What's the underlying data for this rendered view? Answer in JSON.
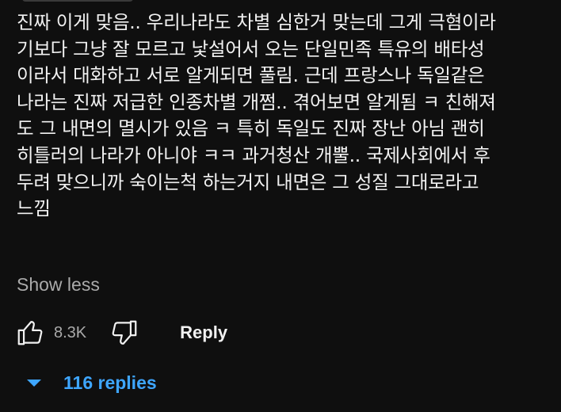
{
  "comment": {
    "lines": [
      "진짜 이게 맞음.. 우리나라도 차별 심한거 맞는데 그게 극혐이라",
      "기보다 그냥 잘 모르고 낯설어서 오는 단일민족 특유의 배타성",
      "이라서 대화하고 서로 알게되면 풀림. 근데 프랑스나 독일같은",
      "나라는 진짜 저급한 인종차별 개쩜.. 겪어보면 알게됨 ㅋ 친해져",
      "도 그 내면의 멸시가 있음 ㅋ 특히 독일도 진짜 장난 아님 괜히",
      "히틀러의 나라가 아니야 ㅋㅋ 과거청산 개뿔.. 국제사회에서 후",
      "두려 맞으니까 숙이는척 하는거지 내면은 그 성질 그대로라고",
      "느낌"
    ],
    "show_less_label": "Show less"
  },
  "actions": {
    "like_icon": "thumbs-up-icon",
    "like_count": "8.3K",
    "dislike_icon": "thumbs-down-icon",
    "reply_label": "Reply"
  },
  "replies": {
    "caret_icon": "caret-down-icon",
    "label": "116 replies"
  },
  "colors": {
    "background": "#0f0f0f",
    "text": "#f1f1f1",
    "muted": "#aaaaaa",
    "accent": "#3ea6ff"
  }
}
